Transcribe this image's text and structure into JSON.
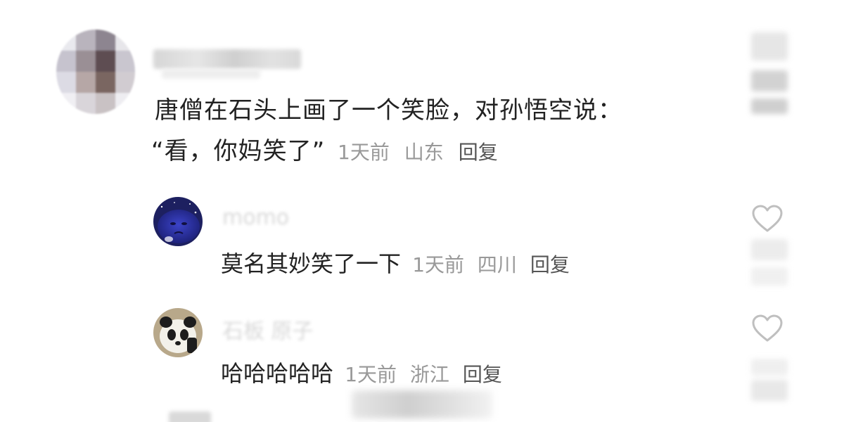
{
  "main_comment": {
    "line1": "唐僧在石头上画了一个笑脸，对孙悟空说：",
    "line2": "“看，你妈笑了”",
    "time": "1天前",
    "location": "山东",
    "reply_label": "回复"
  },
  "replies": [
    {
      "username": "momo",
      "text": "莫名其妙笑了一下",
      "time": "1天前",
      "location": "四川",
      "reply_label": "回复"
    },
    {
      "username": "石板 原子",
      "text": "哈哈哈哈哈",
      "time": "1天前",
      "location": "浙江",
      "reply_label": "回复"
    }
  ],
  "colors": {
    "text": "#222222",
    "meta": "#999999",
    "heart": "#cccccc"
  },
  "icons": {
    "like": "heart-outline-icon"
  }
}
